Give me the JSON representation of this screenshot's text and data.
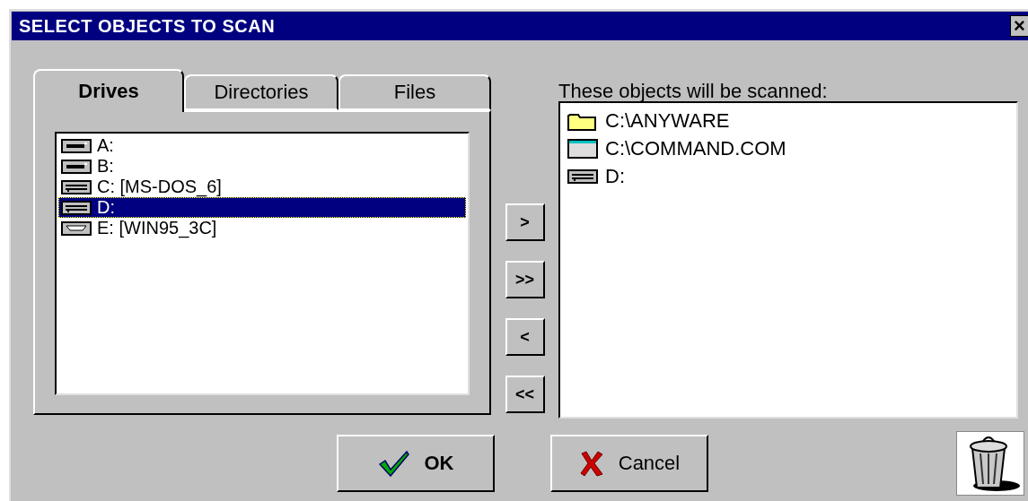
{
  "window": {
    "title": "SELECT OBJECTS TO SCAN",
    "close": "×"
  },
  "tabs": [
    {
      "label": "Drives",
      "selected": true
    },
    {
      "label": "Directories",
      "selected": false
    },
    {
      "label": "Files",
      "selected": false
    }
  ],
  "drives": [
    {
      "kind": "floppy",
      "label": "A:",
      "selected": false
    },
    {
      "kind": "floppy",
      "label": "B:",
      "selected": false
    },
    {
      "kind": "hdd",
      "label": "C: [MS-DOS_6]",
      "selected": false
    },
    {
      "kind": "hdd",
      "label": "D:",
      "selected": true
    },
    {
      "kind": "cdrom",
      "label": "E: [WIN95_3C]",
      "selected": false
    }
  ],
  "move_buttons": [
    ">",
    ">>",
    "<",
    "<<"
  ],
  "scan_list": {
    "label": "These objects will be scanned:",
    "items": [
      {
        "kind": "folder",
        "label": "C:\\ANYWARE"
      },
      {
        "kind": "file",
        "label": "C:\\COMMAND.COM"
      },
      {
        "kind": "hdd",
        "label": "D:"
      }
    ]
  },
  "buttons": [
    {
      "kind": "ok",
      "label": "OK"
    },
    {
      "kind": "cancel",
      "label": "Cancel"
    }
  ]
}
